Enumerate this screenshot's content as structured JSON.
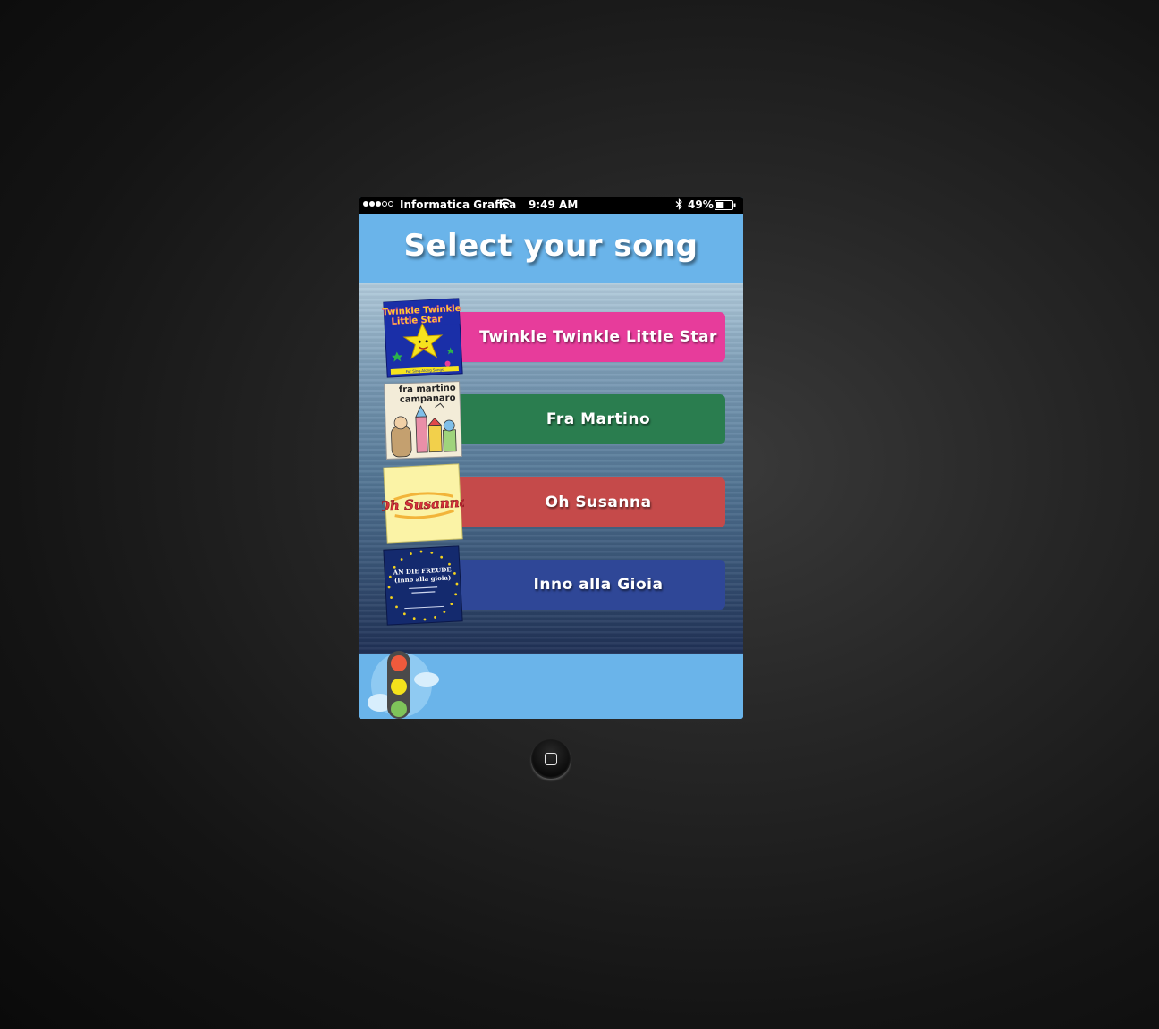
{
  "status_bar": {
    "signal_bars_filled": 3,
    "signal_bars_total": 5,
    "carrier": "Informatica Grafica",
    "time": "9:49 AM",
    "battery_percent": "49%",
    "battery_level": 0.49,
    "icons": [
      "wifi-icon",
      "bluetooth-icon",
      "battery-icon"
    ]
  },
  "header": {
    "title": "Select your song"
  },
  "songs": [
    {
      "label": "Twinkle Twinkle Little Star",
      "color": "#e73c9b",
      "cover": {
        "lines": [
          "Twinkle Twinkle",
          "Little Star"
        ],
        "caption": "For Sing-Along Songs"
      }
    },
    {
      "label": "Fra Martino",
      "color": "#2a7d4f",
      "cover": {
        "lines": [
          "fra martino",
          "campanaro"
        ]
      }
    },
    {
      "label": "Oh Susanna",
      "color": "#c54a4a",
      "cover": {
        "lines": [
          "Oh Susanna"
        ]
      }
    },
    {
      "label": "Inno alla Gioia",
      "color": "#2f4797",
      "cover": {
        "lines": [
          "AN DIE FREUDE",
          "(Inno alla gioia)"
        ]
      }
    }
  ],
  "colors": {
    "sky": "#6ab4ea",
    "status_bar": "#000000",
    "traffic_light_red": "#ef5a3c",
    "traffic_light_yellow": "#f4e21c",
    "traffic_light_green": "#7fc45a"
  },
  "footer": {
    "icon": "traffic-light-icon"
  },
  "home_button": {
    "icon": "home-square-icon"
  }
}
